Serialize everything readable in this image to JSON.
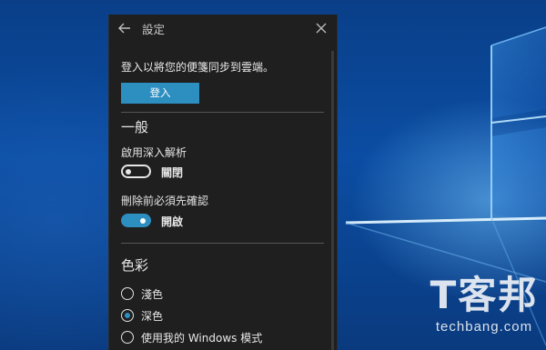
{
  "window": {
    "title": "設定"
  },
  "signin": {
    "prompt": "登入以將您的便箋同步到雲端。",
    "button_label": "登入"
  },
  "general": {
    "heading": "一般",
    "insights": {
      "label": "啟用深入解析",
      "state": "關閉",
      "enabled": false
    },
    "confirm_delete": {
      "label": "刪除前必須先確認",
      "state": "開啟",
      "enabled": true
    }
  },
  "color": {
    "heading": "色彩",
    "options": [
      {
        "label": "淺色",
        "selected": false
      },
      {
        "label": "深色",
        "selected": true
      },
      {
        "label": "使用我的 Windows 模式",
        "selected": false
      }
    ]
  },
  "watermark": {
    "logo": "T客邦",
    "site": "techbang.com"
  },
  "colors": {
    "accent": "#2d8ec0",
    "panel_bg": "#1f1f1f",
    "desktop_bg": "#0a3f86"
  }
}
